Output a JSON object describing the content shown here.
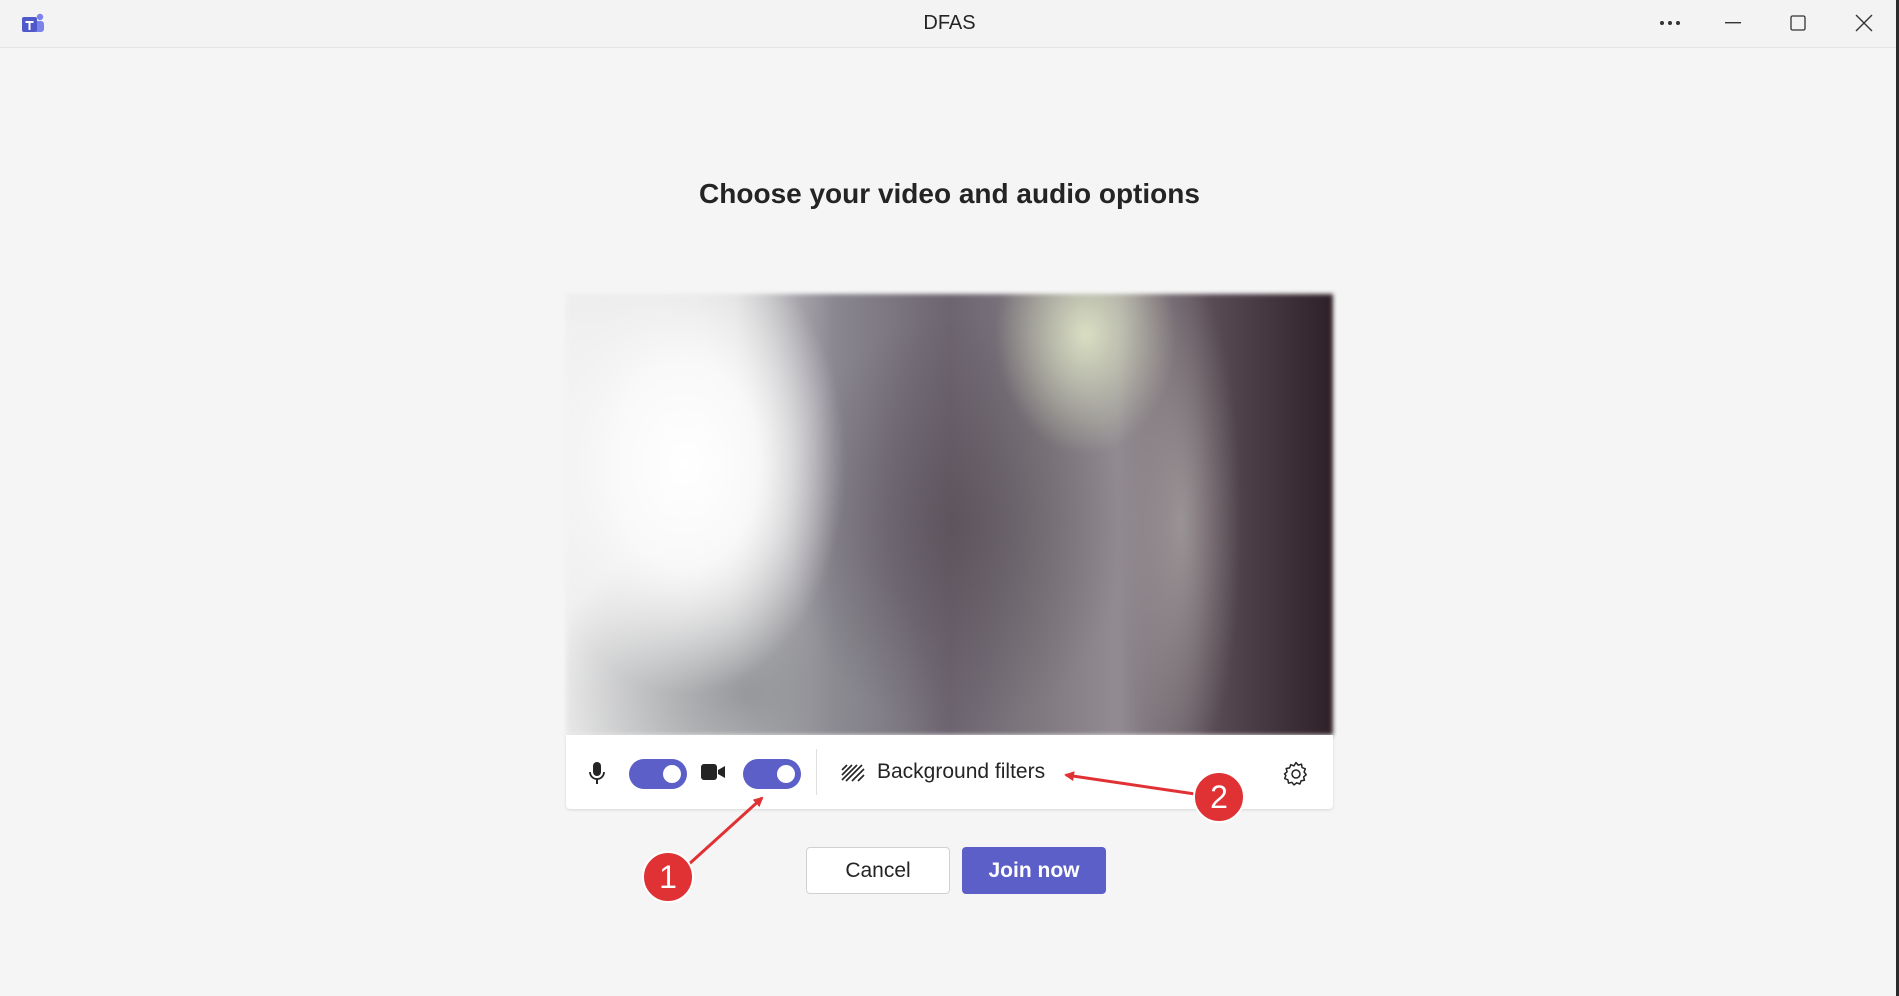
{
  "window": {
    "title": "DFAS",
    "controls": [
      "more-options",
      "minimize",
      "maximize",
      "close"
    ]
  },
  "heading": "Choose your video and audio options",
  "preview": {
    "description": "blurred camera preview"
  },
  "controls": {
    "microphone_on": true,
    "camera_on": true,
    "background_filters_label": "Background filters"
  },
  "buttons": {
    "cancel": "Cancel",
    "join": "Join now"
  },
  "annotations": {
    "marker1": "1",
    "marker2": "2"
  },
  "colors": {
    "accent": "#5b5fc7",
    "annotation": "#e03234"
  }
}
